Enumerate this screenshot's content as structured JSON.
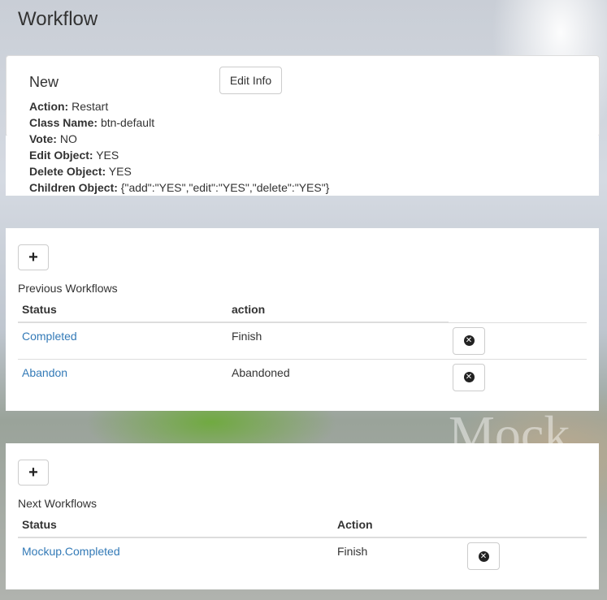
{
  "page": {
    "title": "Workflow"
  },
  "info": {
    "name": "New",
    "edit_label": "Edit Info",
    "fields": [
      {
        "label": "Action:",
        "value": "Restart"
      },
      {
        "label": "Class Name:",
        "value": "btn-default"
      },
      {
        "label": "Vote:",
        "value": "NO"
      },
      {
        "label": "Edit Object:",
        "value": "YES"
      },
      {
        "label": "Delete Object:",
        "value": "YES"
      },
      {
        "label": "Children Object:",
        "value": "{\"add\":\"YES\",\"edit\":\"YES\",\"delete\":\"YES\"}"
      }
    ]
  },
  "previous": {
    "add_label": "+",
    "title": "Previous Workflows",
    "headers": [
      "Status",
      "action"
    ],
    "rows": [
      {
        "status": "Completed",
        "action": "Finish"
      },
      {
        "status": "Abandon",
        "action": "Abandoned"
      }
    ]
  },
  "next": {
    "add_label": "+",
    "title": "Next Workflows",
    "headers": [
      "Status",
      "Action"
    ],
    "rows": [
      {
        "status": "Mockup.Completed",
        "action": "Finish"
      }
    ]
  },
  "background": {
    "watermark": "Mock"
  },
  "icons": {
    "add": "plus-icon",
    "delete": "times-circle-icon"
  }
}
